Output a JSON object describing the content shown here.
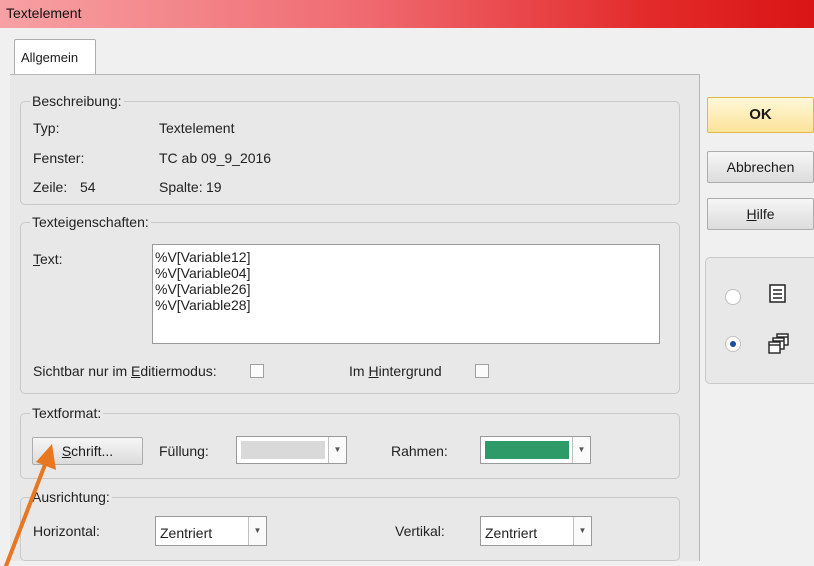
{
  "window": {
    "title": "Textelement"
  },
  "tabs": [
    {
      "label": "Allgemein",
      "active": true
    }
  ],
  "beschreibung": {
    "legend": "Beschreibung:",
    "typ_label": "Typ:",
    "typ_value": "Textelement",
    "fenster_label": "Fenster:",
    "fenster_value": "TC ab 09_9_2016",
    "zeile_label": "Zeile:",
    "zeile_value": "54",
    "spalte_label": "Spalte:",
    "spalte_value": "19"
  },
  "texteigenschaften": {
    "legend": "Texteigenschaften:",
    "text_label_accel": "T",
    "text_label_rest": "ext:",
    "text_lines": [
      "%V[Variable12]",
      "%V[Variable04]",
      "%V[Variable26]",
      "%V[Variable28]"
    ],
    "sichtbar_pre": "Sichtbar nur im ",
    "sichtbar_accel": "E",
    "sichtbar_post": "ditiermodus:",
    "sichtbar_checked": false,
    "hintergrund_pre": "Im ",
    "hintergrund_accel": "H",
    "hintergrund_post": "intergrund",
    "hintergrund_checked": false
  },
  "textformat": {
    "legend": "Textformat:",
    "schrift_accel": "S",
    "schrift_rest": "chrift...",
    "fuellung_label": "Füllung:",
    "fuellung_color": "#d9d9d9",
    "rahmen_label": "Rahmen:",
    "rahmen_color": "#2e9a68"
  },
  "ausrichtung": {
    "legend": "Ausrichtung:",
    "horizontal_label": "Horizontal:",
    "horizontal_value": "Zentriert",
    "vertikal_label": "Vertikal:",
    "vertikal_value": "Zentriert"
  },
  "buttons": {
    "ok": "OK",
    "abbrechen": "Abbrechen",
    "hilfe_accel": "H",
    "hilfe_rest": "ilfe"
  },
  "view_options": [
    {
      "icon": "list-view-icon",
      "selected": false
    },
    {
      "icon": "cascade-windows-icon",
      "selected": true
    }
  ],
  "annotation": {
    "arrow_color": "#e87722",
    "points_to": "schrift-button"
  },
  "colors": {
    "accent_ok": "#fbe39a",
    "titlebar_end": "#d91515"
  }
}
